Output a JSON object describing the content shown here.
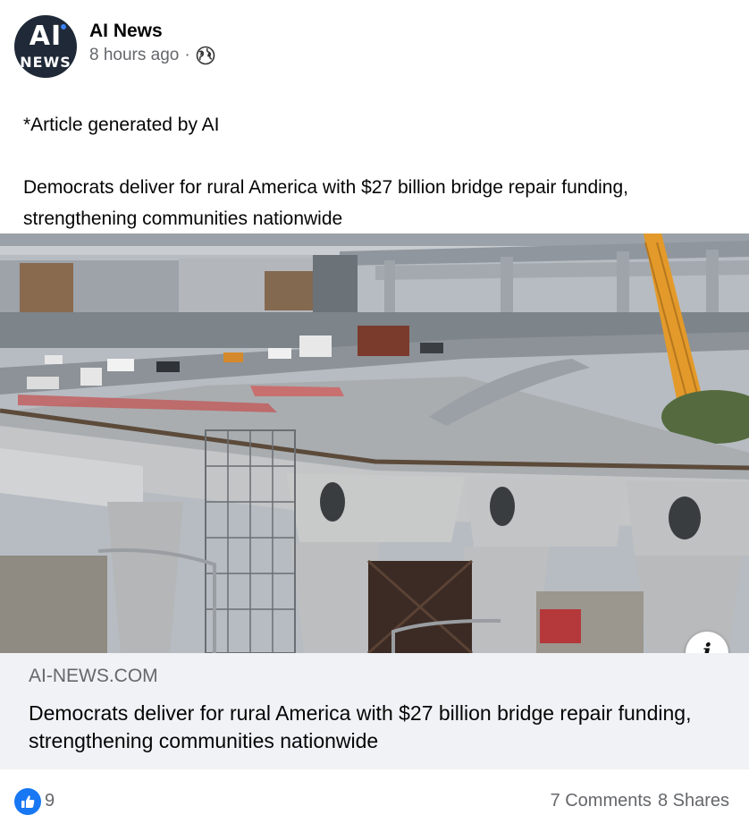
{
  "post": {
    "page_name": "AI News",
    "avatar": {
      "line1": "AI",
      "line2": "NEWS"
    },
    "time": "8 hours ago",
    "separator": "·",
    "privacy_icon": "globe-icon",
    "disclaimer": "*Article generated by AI",
    "body": "Democrats deliver for rural America with $27 billion bridge repair funding, strengthening communities nationwide"
  },
  "link_preview": {
    "image_icon": "bridge-construction-photo",
    "info_icon": "info-icon",
    "domain": "AI-NEWS.COM",
    "title": "Democrats deliver for rural America with $27 billion bridge repair funding, strengthening communities nationwide"
  },
  "engagement": {
    "like_icon": "thumbs-up-icon",
    "likes": "9",
    "comments": "7 Comments",
    "shares": "8 Shares"
  },
  "colors": {
    "brand_blue": "#1877f2",
    "secondary_text": "#65676b",
    "card_background": "#f0f2f5"
  }
}
